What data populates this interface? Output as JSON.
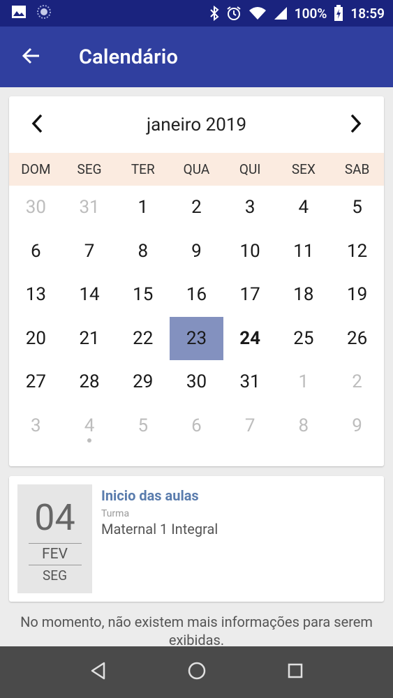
{
  "status_bar": {
    "battery": "100%",
    "time": "18:59"
  },
  "app_bar": {
    "title": "Calendário"
  },
  "calendar": {
    "month_label": "janeiro 2019",
    "weekdays": [
      "DOM",
      "SEG",
      "TER",
      "QUA",
      "QUI",
      "SEX",
      "SAB"
    ],
    "days": [
      {
        "label": "30",
        "muted": true
      },
      {
        "label": "31",
        "muted": true
      },
      {
        "label": "1"
      },
      {
        "label": "2"
      },
      {
        "label": "3"
      },
      {
        "label": "4"
      },
      {
        "label": "5"
      },
      {
        "label": "6"
      },
      {
        "label": "7"
      },
      {
        "label": "8"
      },
      {
        "label": "9"
      },
      {
        "label": "10"
      },
      {
        "label": "11"
      },
      {
        "label": "12"
      },
      {
        "label": "13"
      },
      {
        "label": "14"
      },
      {
        "label": "15"
      },
      {
        "label": "16"
      },
      {
        "label": "17"
      },
      {
        "label": "18"
      },
      {
        "label": "19"
      },
      {
        "label": "20"
      },
      {
        "label": "21"
      },
      {
        "label": "22"
      },
      {
        "label": "23",
        "selected": true
      },
      {
        "label": "24",
        "today": true
      },
      {
        "label": "25"
      },
      {
        "label": "26"
      },
      {
        "label": "27"
      },
      {
        "label": "28"
      },
      {
        "label": "29"
      },
      {
        "label": "30"
      },
      {
        "label": "31"
      },
      {
        "label": "1",
        "muted": true
      },
      {
        "label": "2",
        "muted": true
      },
      {
        "label": "3",
        "muted": true
      },
      {
        "label": "4",
        "muted": true,
        "event_dot": true
      },
      {
        "label": "5",
        "muted": true
      },
      {
        "label": "6",
        "muted": true
      },
      {
        "label": "7",
        "muted": true
      },
      {
        "label": "8",
        "muted": true
      },
      {
        "label": "9",
        "muted": true
      }
    ]
  },
  "event": {
    "day": "04",
    "month": "FEV",
    "weekday": "SEG",
    "title": "Inicio das aulas",
    "group_label": "Turma",
    "group": "Maternal 1 Integral"
  },
  "empty_message": "No momento, não existem mais informações para serem exibidas.",
  "colors": {
    "status_bar": "#1a237e",
    "app_bar": "#303f9f",
    "weekday_bg": "#fbebe0",
    "selected_day": "#8391bf",
    "event_title": "#5a7cad",
    "nav_bar": "#4a4a4a"
  }
}
